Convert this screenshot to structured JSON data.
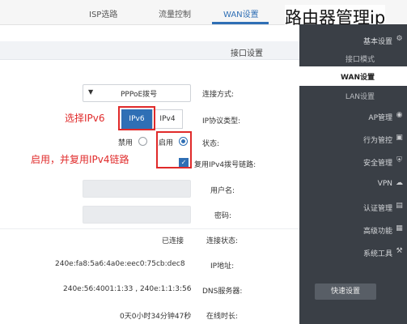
{
  "overlay_title": "路由器管理ip",
  "top_tabs": [
    {
      "label": "ISP选路"
    },
    {
      "label": "流量控制"
    },
    {
      "label": "WAN设置"
    }
  ],
  "section_title": "接口设置",
  "sidebar": {
    "items": [
      {
        "label": "基本设置",
        "icon": "gear-icon",
        "glyph": "⚙"
      },
      {
        "label": "接口模式",
        "icon": ""
      },
      {
        "label": "WAN设置",
        "icon": ""
      },
      {
        "label": "LAN设置",
        "icon": ""
      },
      {
        "label": "AP管理",
        "icon": "ap-icon",
        "glyph": "◉"
      },
      {
        "label": "行为管控",
        "icon": "behavior-icon",
        "glyph": "▣"
      },
      {
        "label": "安全管理",
        "icon": "shield-icon",
        "glyph": "⛨"
      },
      {
        "label": "VPN",
        "icon": "cloud-icon",
        "glyph": "☁"
      },
      {
        "label": "认证管理",
        "icon": "auth-icon",
        "glyph": "▤"
      },
      {
        "label": "高级功能",
        "icon": "grid-icon",
        "glyph": "▦"
      },
      {
        "label": "系统工具",
        "icon": "tools-icon",
        "glyph": "⚒"
      }
    ],
    "quick_setup": "快速设置"
  },
  "form": {
    "connection_type_label": "连接方式:",
    "connection_type_value": "PPPoE拨号",
    "ip_protocol_label": "IP协议类型:",
    "ipv6_label": "IPv6",
    "ipv4_label": "IPv4",
    "status_label": "状态:",
    "enable_label": "启用",
    "disable_label": "禁用",
    "reuse_label": "复用IPv4拨号链路:",
    "username_label": "用户名:",
    "password_label": "密码:",
    "conn_status_label": "连接状态:",
    "conn_status_value": "已连接",
    "ip_address_label": "IP地址:",
    "ip_address_value": "240e:fa8:5a6:4a0e:eec0:75cb:dec8",
    "dns_label": "DNS服务器:",
    "dns_value": "240e:56:4001:1:33 , 240e:1:1:3:56",
    "online_time_label": "在线时长:",
    "online_time_value": "0天0小时34分钟47秒"
  },
  "annotations": {
    "choose_ipv6": "选择IPv6",
    "enable_and_reuse": "启用，并复用IPv4链路"
  },
  "colors": {
    "accent": "#2f6fb5",
    "sidebar_bg": "#3a3f46",
    "annotation_red": "#e02a2a"
  }
}
